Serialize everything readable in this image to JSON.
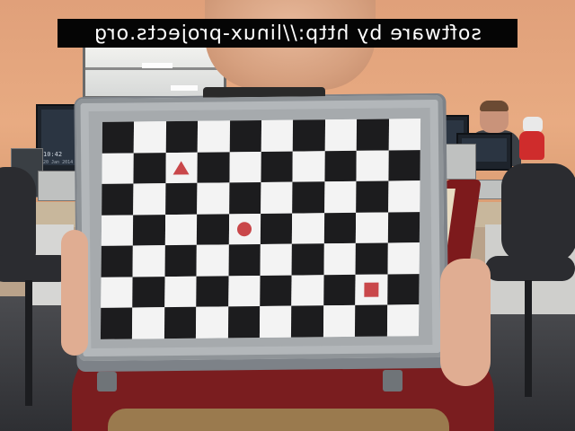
{
  "overlay": {
    "caption": "software by http://linux-projects.org",
    "mirrored": true
  },
  "scene": {
    "background_monitor_clock": "10:42",
    "background_monitor_date": "20 Jan 2014"
  },
  "checkerboard": {
    "columns": 10,
    "rows": 7,
    "top_left_dark": true,
    "square_colors": {
      "dark": "#1c1c1e",
      "light": "#f3f3f3"
    },
    "markers": [
      {
        "shape": "triangle",
        "row": 1,
        "col": 2,
        "color": "#c9474a"
      },
      {
        "shape": "circle",
        "row": 3,
        "col": 4,
        "color": "#c9474a"
      },
      {
        "shape": "square",
        "row": 5,
        "col": 8,
        "color": "#c9474a"
      }
    ]
  },
  "colors": {
    "wall": "#e8ab82",
    "board_frame": "#a6aaad",
    "jersey": "#7a1d1f"
  }
}
